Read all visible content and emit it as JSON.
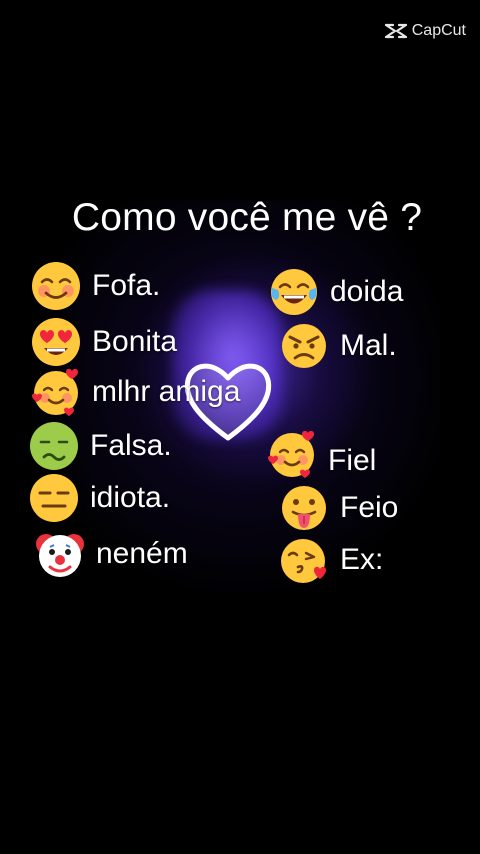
{
  "watermark": {
    "brand": "CapCut",
    "icon": "capcut-logo-icon"
  },
  "title": "Como você me vê ?",
  "left_items": [
    {
      "emoji": "smiling-blush-emoji",
      "label": "Fofa."
    },
    {
      "emoji": "heart-eyes-emoji",
      "label": "Bonita"
    },
    {
      "emoji": "smiling-with-hearts-emoji",
      "label": "mlhr amiga"
    },
    {
      "emoji": "nauseated-face-emoji",
      "label": "Falsa."
    },
    {
      "emoji": "expressionless-face-emoji",
      "label": "idiota."
    },
    {
      "emoji": "clown-face-emoji",
      "label": "neném"
    }
  ],
  "right_items": [
    {
      "emoji": "tears-of-joy-emoji",
      "label": "doida"
    },
    {
      "emoji": "angry-face-emoji",
      "label": "Mal."
    },
    {
      "emoji": "smiling-with-hearts-emoji",
      "label": "Fiel"
    },
    {
      "emoji": "tongue-out-emoji",
      "label": "Feio"
    },
    {
      "emoji": "kissing-heart-emoji",
      "label": "Ex:"
    }
  ],
  "colors": {
    "background": "#000000",
    "glow": "#6e46ff",
    "text": "#ffffff"
  }
}
